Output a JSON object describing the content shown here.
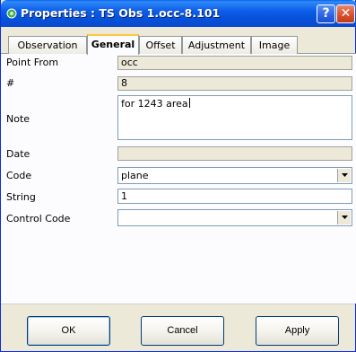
{
  "window": {
    "title": "Properties : TS Obs 1.occ-8.101",
    "help_label": "?",
    "close_label": "✕"
  },
  "tabs": [
    {
      "label": "Observation",
      "selected": false
    },
    {
      "label": "General",
      "selected": true
    },
    {
      "label": "Offset",
      "selected": false
    },
    {
      "label": "Adjustment",
      "selected": false
    },
    {
      "label": "Image",
      "selected": false
    }
  ],
  "form": {
    "point_from": {
      "label": "Point From",
      "value": "occ"
    },
    "number": {
      "label": "#",
      "value": "8"
    },
    "note": {
      "label": "Note",
      "value": "for 1243 area"
    },
    "date": {
      "label": "Date",
      "value": ""
    },
    "code": {
      "label": "Code",
      "value": "plane"
    },
    "string": {
      "label": "String",
      "value": "1"
    },
    "control_code": {
      "label": "Control Code",
      "value": ""
    }
  },
  "buttons": {
    "ok": "OK",
    "cancel": "Cancel",
    "apply": "Apply"
  },
  "icons": {
    "app": "properties-app-icon",
    "dropdown": "chevron-down-icon"
  }
}
